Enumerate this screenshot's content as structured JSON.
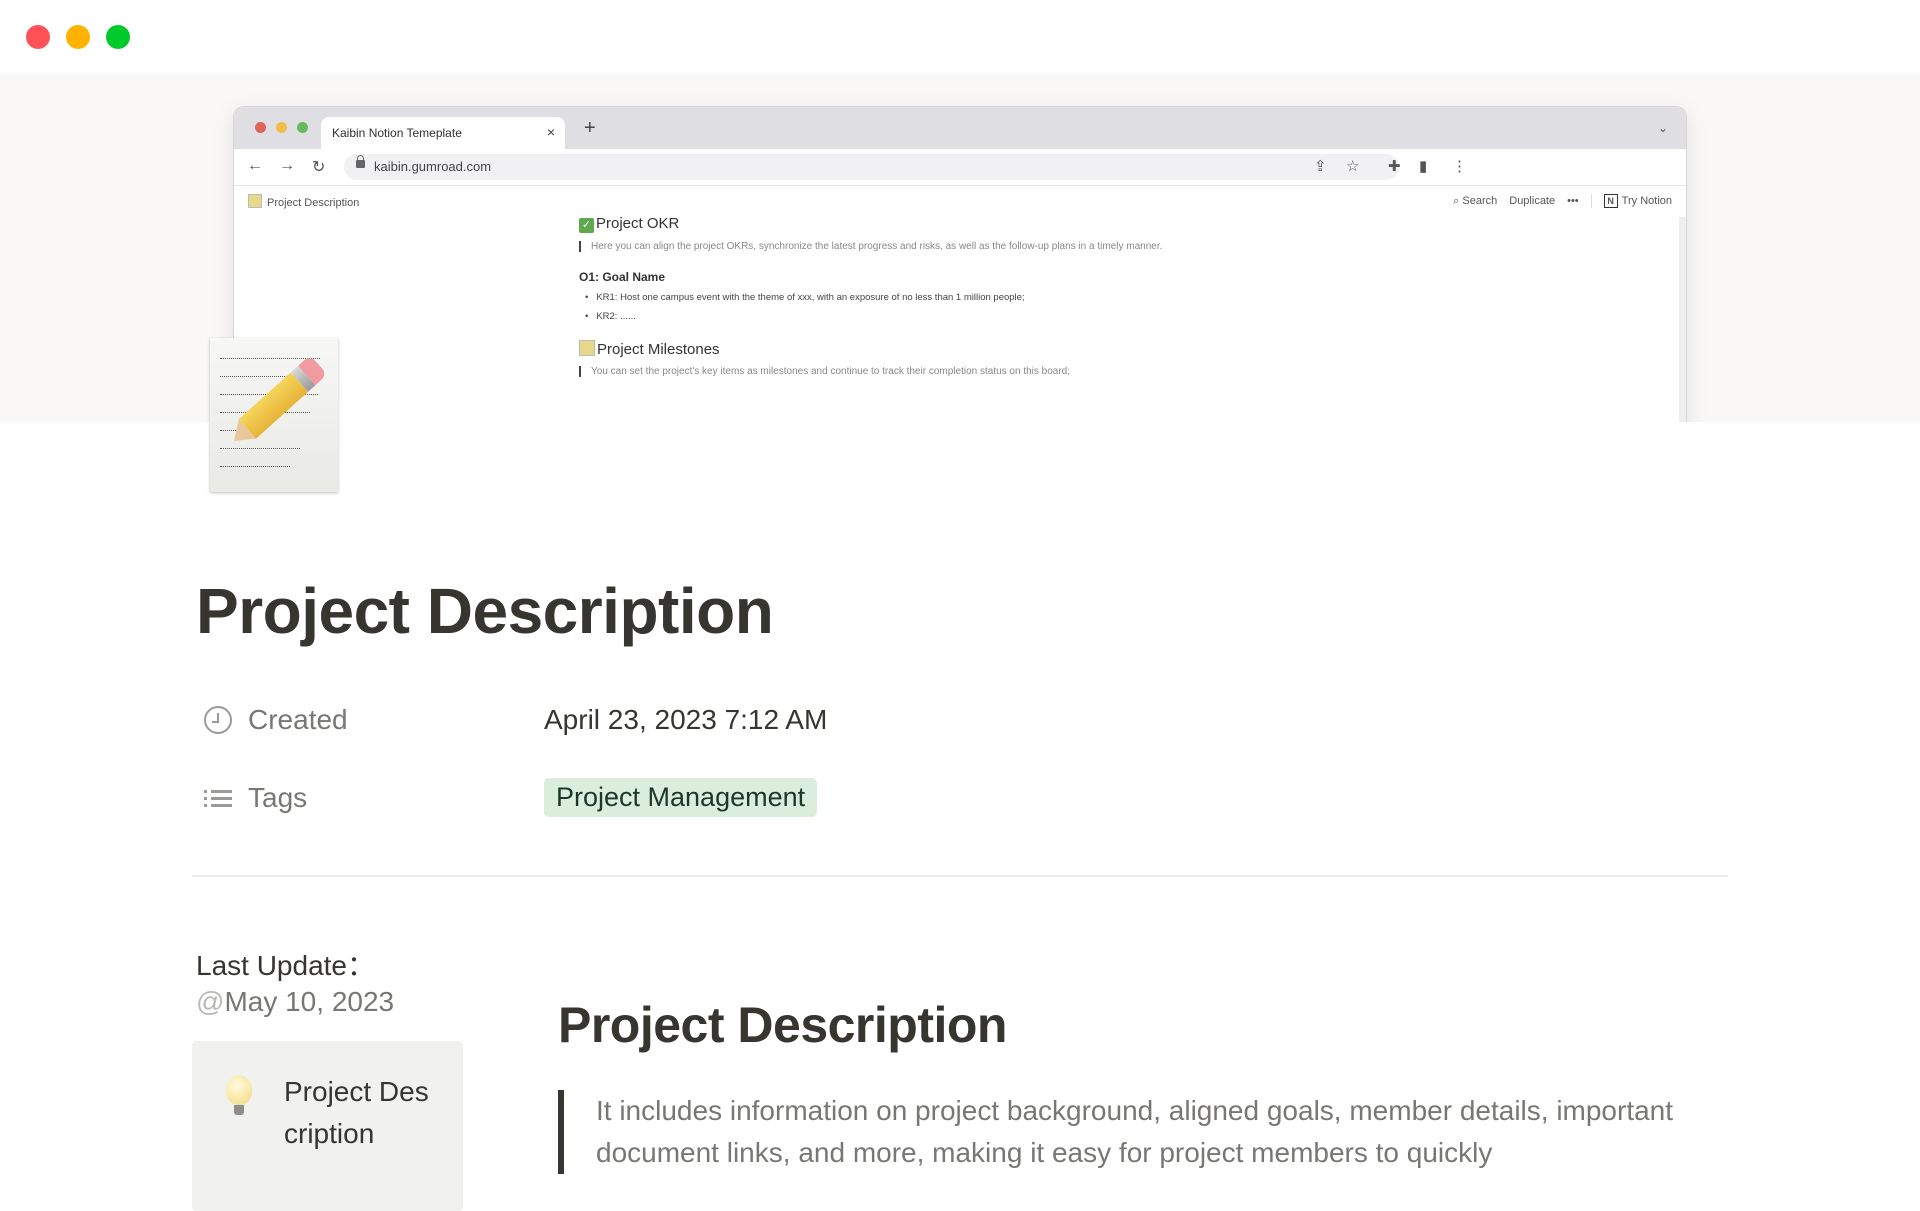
{
  "window": {
    "traffic_lights": [
      "close",
      "minimize",
      "zoom"
    ]
  },
  "cover": {
    "browser": {
      "tab_title": "Kaibin Notion Temeplate",
      "tab_close": "×",
      "new_tab": "+",
      "collapse": "⌄",
      "nav": {
        "back": "←",
        "forward": "→",
        "reload": "↻"
      },
      "url": "kaibin.gumroad.com",
      "actions": {
        "share": "⇪",
        "bookmark": "☆",
        "extensions": "✚",
        "sidepanel": "▮",
        "menu": "⋮"
      },
      "notion": {
        "breadcrumb": "Project Description",
        "search": "⌕ Search",
        "duplicate": "Duplicate",
        "more": "•••",
        "try_notion": "Try Notion",
        "notion_logo": "N",
        "okr_heading": "Project OKR",
        "okr_check": "✓",
        "okr_quote": "Here you can align the project OKRs, synchronize the latest progress and risks, as well as the follow-up plans in a timely manner.",
        "goal_heading": "O1: Goal Name",
        "kr_items": [
          "KR1: Host one campus event with the theme of xxx, with an exposure of no less than 1 million people;",
          "KR2: ......"
        ],
        "milestones_heading": "Project Milestones",
        "milestones_quote": "You can set the project's key items as milestones and continue to track their completion status on this board;"
      }
    }
  },
  "page": {
    "icon": "memo-pencil",
    "title": "Project Description",
    "properties": [
      {
        "icon": "clock-icon",
        "label": "Created",
        "value": "April 23, 2023 7:12 AM"
      },
      {
        "icon": "list-icon",
        "label": "Tags",
        "tag": "Project Management"
      }
    ],
    "tag_colors": {
      "bg": "#dbeddb",
      "text": "#1c3829"
    },
    "last_update_label": "Last Update：",
    "last_update_at": "@",
    "last_update_date": "May 10, 2023",
    "callout": {
      "icon": "lightbulb",
      "text": "Project Description"
    },
    "section_heading": "Project Description",
    "section_quote": "It includes information on project background, aligned goals, member details, important document links, and more, making it easy for project members to quickly"
  }
}
